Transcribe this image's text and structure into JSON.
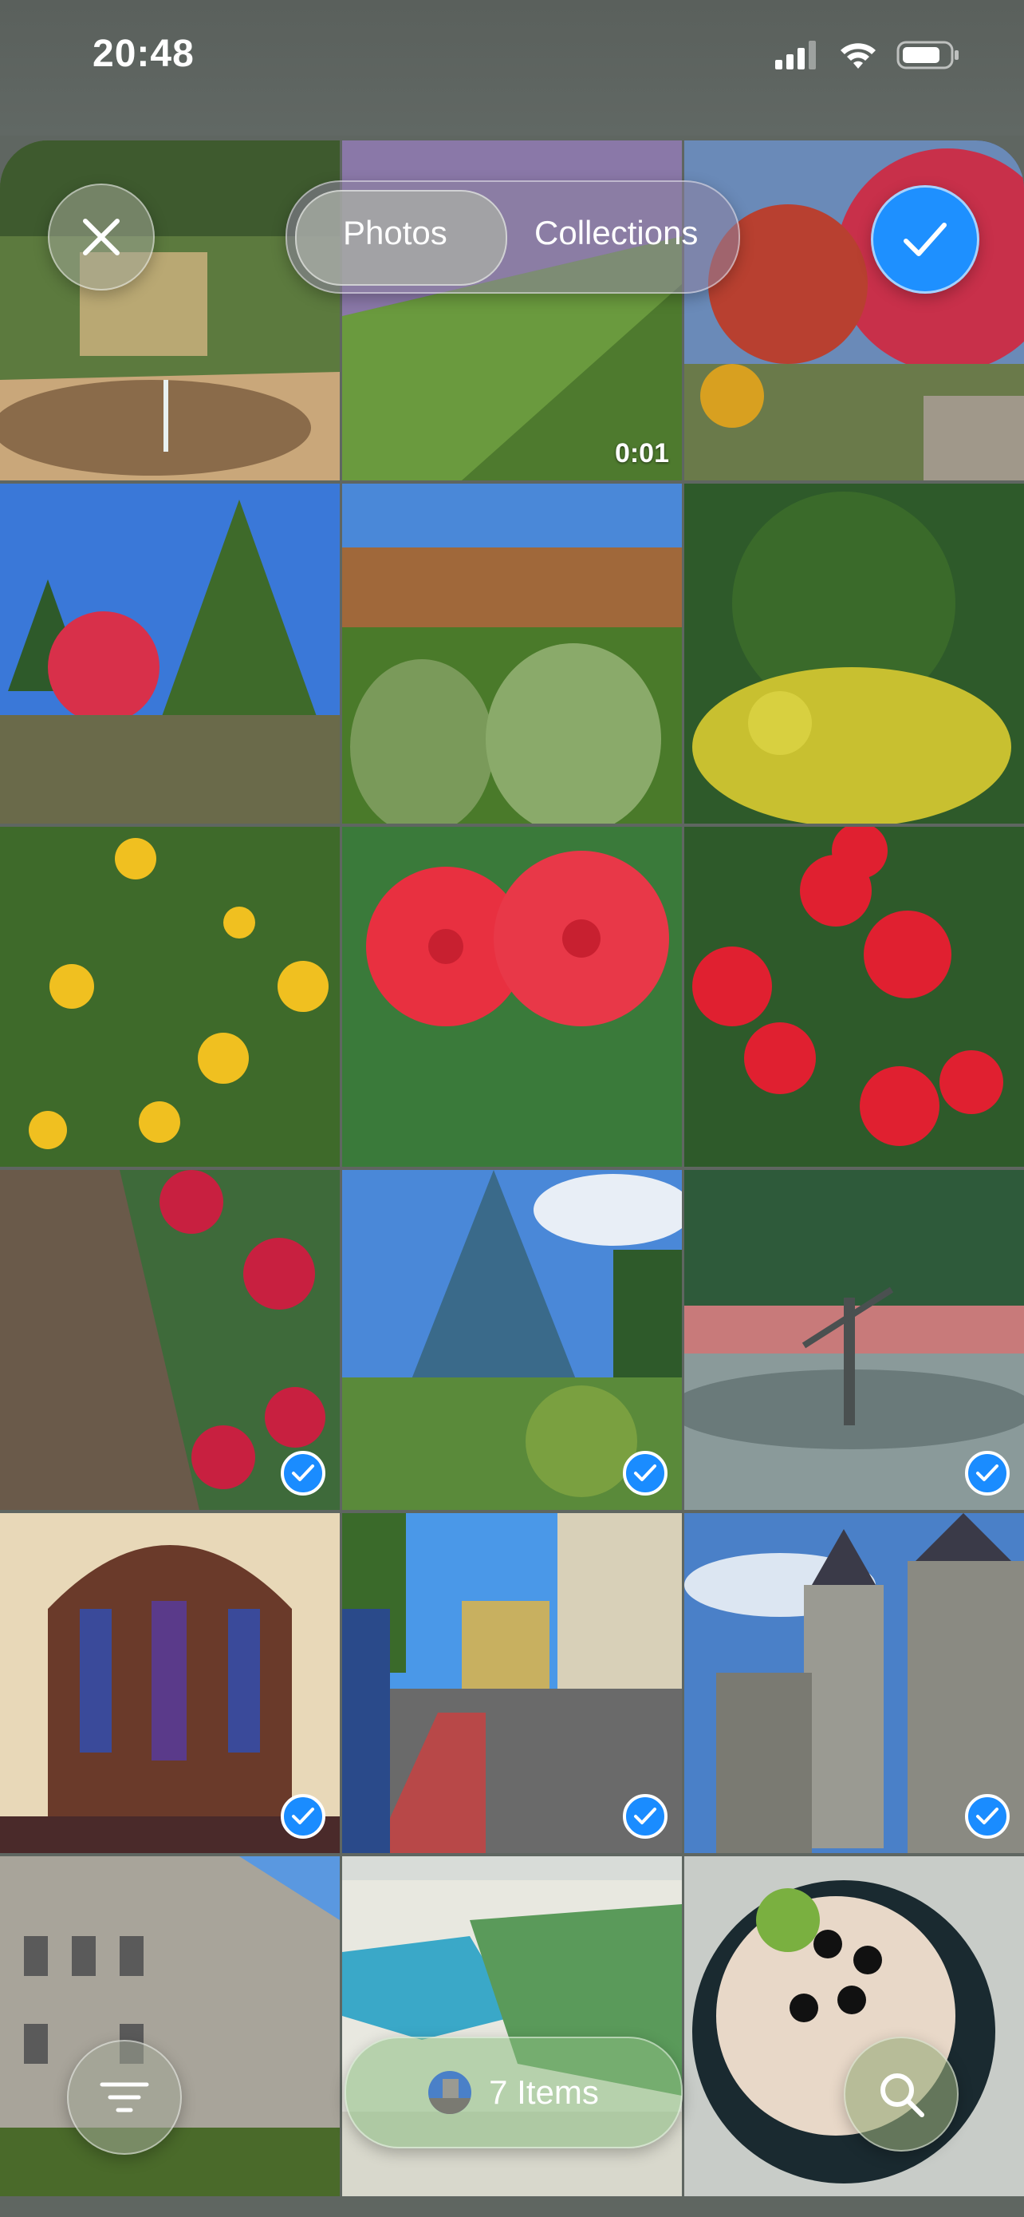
{
  "status_bar": {
    "time": "20:48"
  },
  "header": {
    "close_icon": "xmark-icon",
    "segments": [
      {
        "label": "Photos",
        "selected": true
      },
      {
        "label": "Collections",
        "selected": false
      }
    ],
    "done_icon": "checkmark-icon",
    "accent_color": "#1e90ff"
  },
  "grid": {
    "photos": [
      {
        "name": "garden-fountain",
        "selected": false,
        "duration": ""
      },
      {
        "name": "heather-slope-video",
        "selected": false,
        "duration": "0:01"
      },
      {
        "name": "red-maple-rockery",
        "selected": false,
        "duration": ""
      },
      {
        "name": "conifer-red-shrub",
        "selected": false,
        "duration": ""
      },
      {
        "name": "dwarf-pines",
        "selected": false,
        "duration": ""
      },
      {
        "name": "yellow-shrubs",
        "selected": false,
        "duration": ""
      },
      {
        "name": "yellow-dahlias",
        "selected": false,
        "duration": ""
      },
      {
        "name": "red-dahlias-closeup",
        "selected": false,
        "duration": ""
      },
      {
        "name": "red-dahlias-bed",
        "selected": false,
        "duration": ""
      },
      {
        "name": "red-white-dahlias",
        "selected": true,
        "duration": ""
      },
      {
        "name": "blue-spruce",
        "selected": true,
        "duration": ""
      },
      {
        "name": "ballerina-fountain",
        "selected": true,
        "duration": ""
      },
      {
        "name": "church-interior",
        "selected": true,
        "duration": ""
      },
      {
        "name": "tram-street",
        "selected": true,
        "duration": ""
      },
      {
        "name": "castle-tower",
        "selected": true,
        "duration": ""
      },
      {
        "name": "castle-facade",
        "selected": false,
        "duration": ""
      },
      {
        "name": "park-map-sign",
        "selected": false,
        "duration": ""
      },
      {
        "name": "salad-bowl",
        "selected": false,
        "duration": ""
      }
    ]
  },
  "bottom_bar": {
    "filter_icon": "filter-lines-icon",
    "items_label": "7 Items",
    "search_icon": "magnifier-icon"
  }
}
